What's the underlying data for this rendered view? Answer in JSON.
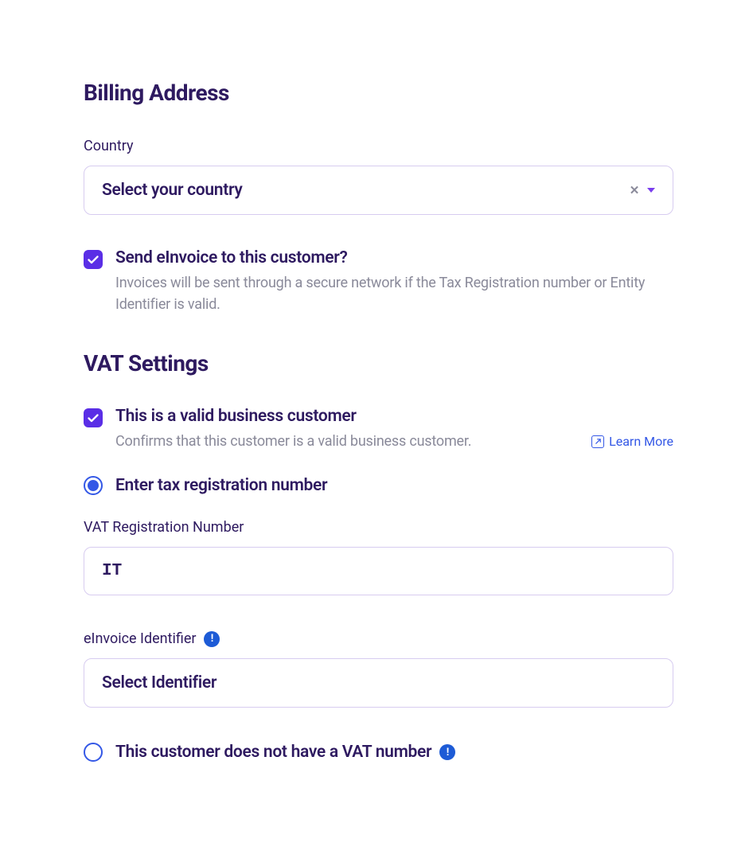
{
  "billing": {
    "heading": "Billing Address",
    "country_label": "Country",
    "country_placeholder": "Select your country",
    "einvoice_label": "Send eInvoice to this customer?",
    "einvoice_desc": "Invoices will be sent through a secure network if the Tax Registration number or Entity Identifier is valid."
  },
  "vat": {
    "heading": "VAT Settings",
    "valid_biz_label": "This is a valid business customer",
    "valid_biz_desc": "Confirms that this customer is a valid business customer.",
    "learn_more": "Learn More",
    "enter_tax_label": "Enter tax registration number",
    "vat_reg_label": "VAT Registration Number",
    "vat_reg_value": "IT",
    "einvoice_id_label": "eInvoice Identifier",
    "einvoice_id_placeholder": "Select Identifier",
    "no_vat_label": "This customer does not have a VAT number"
  }
}
